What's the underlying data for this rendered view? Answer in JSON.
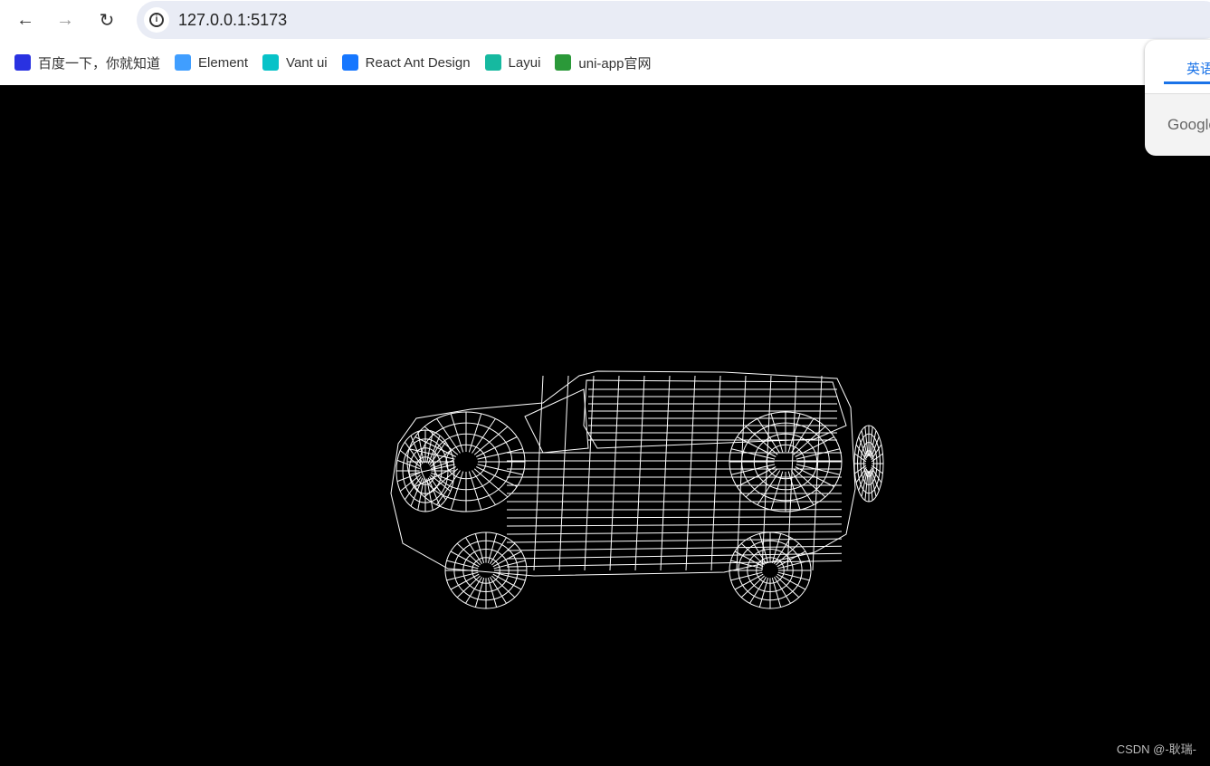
{
  "toolbar": {
    "back_icon": "arrow-left-icon",
    "forward_icon": "arrow-right-icon",
    "reload_icon": "reload-icon",
    "url": "127.0.0.1:5173"
  },
  "bookmarks": [
    {
      "label": "百度一下，你就知道",
      "icon": "baidu-paw-icon",
      "color": "#2932e1"
    },
    {
      "label": "Element",
      "icon": "element-icon",
      "color": "#409eff"
    },
    {
      "label": "Vant ui",
      "icon": "vant-icon",
      "color": "#07c2c8"
    },
    {
      "label": "React Ant Design",
      "icon": "ant-design-icon",
      "color": "#1677ff"
    },
    {
      "label": "Layui",
      "icon": "layui-icon",
      "color": "#16b9a0"
    },
    {
      "label": "uni-app官网",
      "icon": "uniapp-icon",
      "color": "#2b9939"
    }
  ],
  "translate_popup": {
    "tab": "英语",
    "brand": "Google"
  },
  "scene": {
    "content": "wireframe car model",
    "stroke_color": "#ffffff",
    "background": "#000000"
  },
  "watermark": "CSDN @-耿瑞-"
}
